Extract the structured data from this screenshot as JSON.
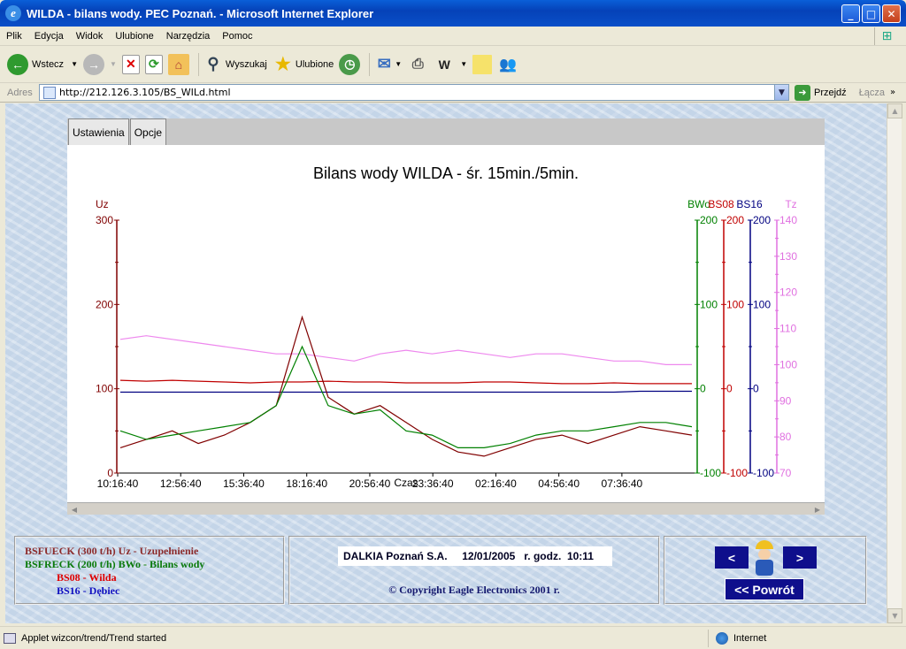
{
  "window": {
    "title": "WILDA - bilans wody. PEC Poznań. - Microsoft Internet Explorer"
  },
  "menu": [
    "Plik",
    "Edycja",
    "Widok",
    "Ulubione",
    "Narzędzia",
    "Pomoc"
  ],
  "toolbar": {
    "back": "Wstecz",
    "search": "Wyszukaj",
    "favorites": "Ulubione"
  },
  "address": {
    "label": "Adres",
    "url": "http://212.126.3.105/BS_WILd.html",
    "go": "Przejdź",
    "links": "Łącza"
  },
  "applet": {
    "tabs": [
      "Ustawienia",
      "Opcje"
    ]
  },
  "chart_data": {
    "type": "line",
    "title": "Bilans wody WILDA - śr. 15min./5min.",
    "xlabel": "Czas",
    "x_ticks": [
      "10:16:40",
      "12:56:40",
      "15:36:40",
      "18:16:40",
      "20:56:40",
      "23:36:40",
      "02:16:40",
      "04:56:40",
      "07:36:40"
    ],
    "axes": [
      {
        "label": "Uz",
        "ticks": [
          "300",
          "200",
          "100",
          "0"
        ],
        "range": [
          0,
          300
        ],
        "color": "#800000",
        "side": "left"
      },
      {
        "label": "BWo",
        "ticks": [
          "200",
          "100",
          "0",
          "-100"
        ],
        "range": [
          -100,
          200
        ],
        "color": "#008000",
        "side": "right"
      },
      {
        "label": "BS08",
        "ticks": [
          "200",
          "100",
          "0",
          "-100"
        ],
        "range": [
          -100,
          200
        ],
        "color": "#c00000",
        "side": "right"
      },
      {
        "label": "BS16",
        "ticks": [
          "200",
          "100",
          "0",
          "-100"
        ],
        "range": [
          -100,
          200
        ],
        "color": "#000080",
        "side": "right"
      },
      {
        "label": "Tz",
        "ticks": [
          "140",
          "130",
          "120",
          "110",
          "100",
          "90",
          "80",
          "70"
        ],
        "range": [
          70,
          140
        ],
        "color": "#e070e0",
        "side": "right"
      }
    ],
    "series": [
      {
        "name": "Tz",
        "axis": "Tz",
        "color": "#ee88ee",
        "values": [
          107,
          108,
          107,
          106,
          105,
          104,
          103,
          103,
          102,
          101,
          103,
          104,
          103,
          104,
          103,
          102,
          103,
          103,
          102,
          101,
          101,
          100,
          100
        ]
      },
      {
        "name": "BS08",
        "axis": "BS08",
        "color": "#c00000",
        "values": [
          10,
          9,
          10,
          9,
          8,
          7,
          8,
          8,
          9,
          8,
          8,
          7,
          7,
          7,
          8,
          8,
          7,
          6,
          6,
          7,
          6,
          6,
          6
        ]
      },
      {
        "name": "BS16",
        "axis": "BS16",
        "color": "#000080",
        "values": [
          -4,
          -4,
          -4,
          -4,
          -4,
          -4,
          -4,
          -4,
          -4,
          -4,
          -4,
          -4,
          -4,
          -4,
          -4,
          -4,
          -4,
          -4,
          -4,
          -4,
          -3,
          -3,
          -3
        ]
      },
      {
        "name": "Uz",
        "axis": "Uz",
        "color": "#800000",
        "values": [
          30,
          40,
          50,
          35,
          45,
          60,
          80,
          185,
          90,
          70,
          80,
          60,
          40,
          25,
          20,
          30,
          40,
          45,
          35,
          45,
          55,
          50,
          45
        ]
      },
      {
        "name": "BWo",
        "axis": "BWo",
        "color": "#008000",
        "values": [
          -50,
          -60,
          -55,
          -50,
          -45,
          -40,
          -20,
          50,
          -20,
          -30,
          -25,
          -50,
          -55,
          -70,
          -70,
          -65,
          -55,
          -50,
          -50,
          -45,
          -40,
          -40,
          -45
        ]
      }
    ]
  },
  "legend": {
    "items": [
      {
        "text": "BSFUECK (300 t/h) Uz - Uzupełnienie",
        "color": "#8b2a2a"
      },
      {
        "text": "BSFRECK (200 t/h) BWo - Bilans wody",
        "color": "#0a7a0a"
      },
      {
        "text": "BS08 - Wilda",
        "color": "#e00000"
      },
      {
        "text": "BS16 - Dębiec",
        "color": "#1010c0"
      }
    ]
  },
  "info": {
    "banner": "DALKIA Poznań S.A.     12/01/2005   r. godz.  10:11",
    "copyright": "© Copyright Eagle Electronics 2001 r."
  },
  "nav": {
    "prev": "<",
    "next": ">",
    "back": "<<  Powrót"
  },
  "status": {
    "text": "Applet wizcon/trend/Trend started",
    "zone": "Internet"
  }
}
